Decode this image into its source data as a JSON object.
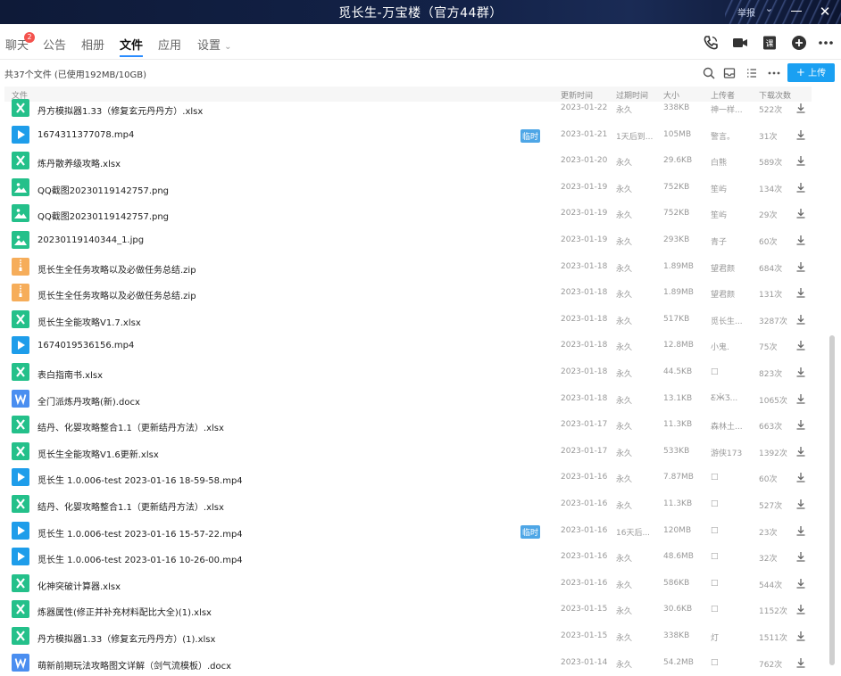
{
  "window": {
    "title": "觅长生-万宝楼（官方44群）",
    "report_label": "举报",
    "close_glyph": "✕"
  },
  "tabs": [
    {
      "label": "聊天",
      "badge": "2"
    },
    {
      "label": "公告"
    },
    {
      "label": "相册"
    },
    {
      "label": "文件"
    },
    {
      "label": "应用"
    },
    {
      "label": "设置"
    }
  ],
  "header_icons": [
    "phone-icon",
    "video-icon",
    "class-icon",
    "add-icon",
    "more-icon"
  ],
  "info": {
    "count_text": "共37个文件 (已使用192MB/10GB)",
    "upload_label": "上传"
  },
  "toolbar_icons": [
    "search-icon",
    "inbox-icon",
    "list-view-icon",
    "more-icon"
  ],
  "columns": {
    "name": "文件",
    "date": "更新时间",
    "expire": "过期时间",
    "size": "大小",
    "uploader": "上传者",
    "downloads": "下载次数"
  },
  "files": [
    {
      "name": "丹方模拟器1.33（修复玄元丹丹方）.xlsx",
      "type": "xlsx",
      "tag": "",
      "date": "2023-01-22",
      "expire": "永久",
      "size": "338KB",
      "uploader": "神一样...",
      "downloads": "522次"
    },
    {
      "name": "1674311377078.mp4",
      "type": "mp4",
      "tag": "临时",
      "date": "2023-01-21",
      "expire": "1天后到...",
      "size": "105MB",
      "uploader": "警言。",
      "downloads": "31次"
    },
    {
      "name": "炼丹散养级攻略.xlsx",
      "type": "xlsx",
      "tag": "",
      "date": "2023-01-20",
      "expire": "永久",
      "size": "29.6KB",
      "uploader": "白熊",
      "downloads": "589次"
    },
    {
      "name": "QQ截图20230119142757.png",
      "type": "png",
      "tag": "",
      "date": "2023-01-19",
      "expire": "永久",
      "size": "752KB",
      "uploader": "笙屿",
      "downloads": "134次"
    },
    {
      "name": "QQ截图20230119142757.png",
      "type": "png",
      "tag": "",
      "date": "2023-01-19",
      "expire": "永久",
      "size": "752KB",
      "uploader": "笙屿",
      "downloads": "29次"
    },
    {
      "name": "20230119140344_1.jpg",
      "type": "png",
      "tag": "",
      "date": "2023-01-19",
      "expire": "永久",
      "size": "293KB",
      "uploader": "青子",
      "downloads": "60次"
    },
    {
      "name": "觅长生全任务攻略以及必做任务总结.zip",
      "type": "zip",
      "tag": "",
      "date": "2023-01-18",
      "expire": "永久",
      "size": "1.89MB",
      "uploader": "望君颜",
      "downloads": "684次"
    },
    {
      "name": "觅长生全任务攻略以及必做任务总结.zip",
      "type": "zip",
      "tag": "",
      "date": "2023-01-18",
      "expire": "永久",
      "size": "1.89MB",
      "uploader": "望君颜",
      "downloads": "131次"
    },
    {
      "name": "觅长生全能攻略V1.7.xlsx",
      "type": "xlsx",
      "tag": "",
      "date": "2023-01-18",
      "expire": "永久",
      "size": "517KB",
      "uploader": "觅长生...",
      "downloads": "3287次"
    },
    {
      "name": "1674019536156.mp4",
      "type": "mp4",
      "tag": "",
      "date": "2023-01-18",
      "expire": "永久",
      "size": "12.8MB",
      "uploader": "小鬼.",
      "downloads": "75次"
    },
    {
      "name": "表白指南书.xlsx",
      "type": "xlsx",
      "tag": "",
      "date": "2023-01-18",
      "expire": "永久",
      "size": "44.5KB",
      "uploader": "□",
      "downloads": "823次"
    },
    {
      "name": "全门派炼丹攻略(新).docx",
      "type": "docx",
      "tag": "",
      "date": "2023-01-18",
      "expire": "永久",
      "size": "13.1KB",
      "uploader": "Ƹ̴Ӂ̴Ʒ...",
      "downloads": "1065次"
    },
    {
      "name": "结丹、化婴攻略整合1.1（更新结丹方法）.xlsx",
      "type": "xlsx",
      "tag": "",
      "date": "2023-01-17",
      "expire": "永久",
      "size": "11.3KB",
      "uploader": "森林土...",
      "downloads": "663次"
    },
    {
      "name": "觅长生全能攻略V1.6更新.xlsx",
      "type": "xlsx",
      "tag": "",
      "date": "2023-01-17",
      "expire": "永久",
      "size": "533KB",
      "uploader": "游侠173",
      "downloads": "1392次"
    },
    {
      "name": "觅长生 1.0.006-test 2023-01-16 18-59-58.mp4",
      "type": "mp4",
      "tag": "",
      "date": "2023-01-16",
      "expire": "永久",
      "size": "7.87MB",
      "uploader": "□",
      "downloads": "60次"
    },
    {
      "name": "结丹、化婴攻略整合1.1（更新结丹方法）.xlsx",
      "type": "xlsx",
      "tag": "",
      "date": "2023-01-16",
      "expire": "永久",
      "size": "11.3KB",
      "uploader": "□",
      "downloads": "527次"
    },
    {
      "name": "觅长生 1.0.006-test 2023-01-16 15-57-22.mp4",
      "type": "mp4",
      "tag": "临时",
      "date": "2023-01-16",
      "expire": "16天后...",
      "size": "120MB",
      "uploader": "□",
      "downloads": "23次"
    },
    {
      "name": "觅长生 1.0.006-test 2023-01-16 10-26-00.mp4",
      "type": "mp4",
      "tag": "",
      "date": "2023-01-16",
      "expire": "永久",
      "size": "48.6MB",
      "uploader": "□",
      "downloads": "32次"
    },
    {
      "name": "化神突破计算器.xlsx",
      "type": "xlsx",
      "tag": "",
      "date": "2023-01-16",
      "expire": "永久",
      "size": "586KB",
      "uploader": "□",
      "downloads": "544次"
    },
    {
      "name": "炼器属性(修正并补充材料配比大全)(1).xlsx",
      "type": "xlsx",
      "tag": "",
      "date": "2023-01-15",
      "expire": "永久",
      "size": "30.6KB",
      "uploader": "□",
      "downloads": "1152次"
    },
    {
      "name": "丹方模拟器1.33（修复玄元丹丹方）(1).xlsx",
      "type": "xlsx",
      "tag": "",
      "date": "2023-01-15",
      "expire": "永久",
      "size": "338KB",
      "uploader": "灯",
      "downloads": "1511次"
    },
    {
      "name": "萌新前期玩法攻略图文详解（剑气流模板）.docx",
      "type": "docx",
      "tag": "",
      "date": "2023-01-14",
      "expire": "永久",
      "size": "54.2MB",
      "uploader": "□",
      "downloads": "762次"
    }
  ],
  "colors": {
    "accent": "#2a8cff",
    "upload": "#1aa0f2",
    "xlsx": "#24c08a",
    "mp4": "#1e9dea",
    "zip": "#f6ad5a",
    "docx": "#4a8ef0",
    "temp_tag": "#4ea6e6"
  }
}
